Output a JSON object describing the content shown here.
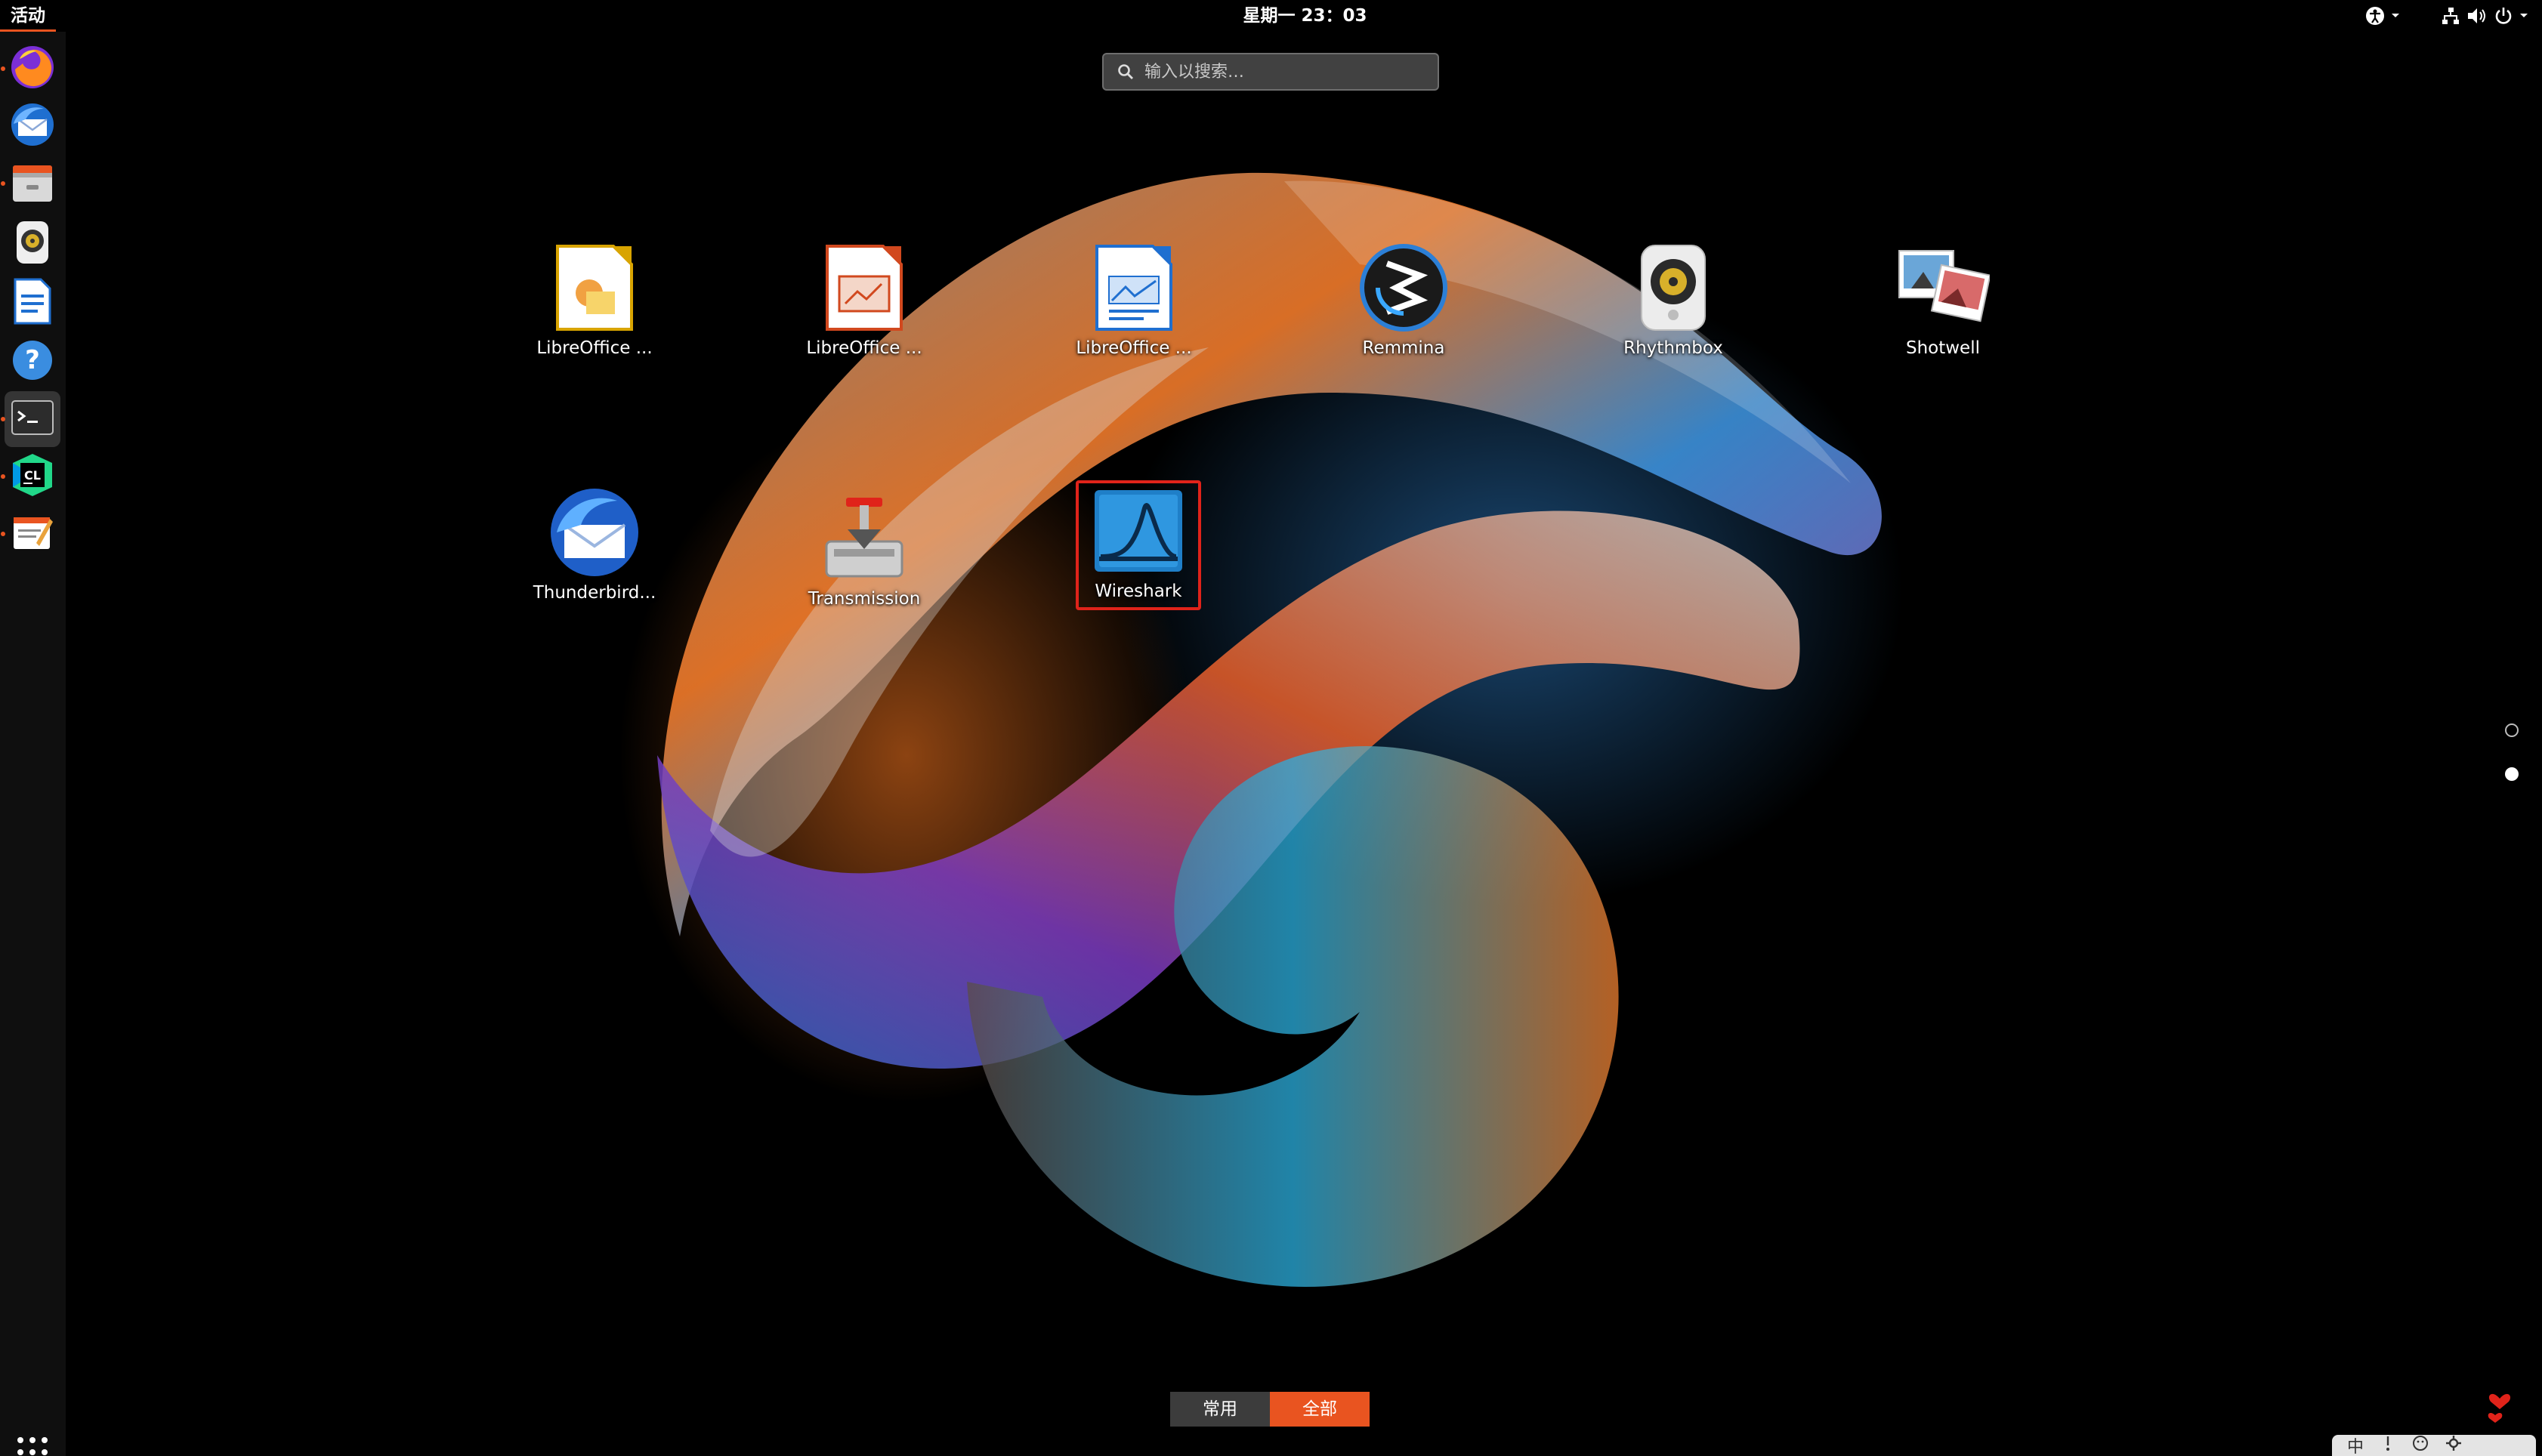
{
  "topbar": {
    "activities_label": "活动",
    "clock": "星期一 23：03"
  },
  "search": {
    "placeholder": "输入以搜索…"
  },
  "dock": {
    "items": [
      {
        "name": "Firefox",
        "icon": "firefox-icon"
      },
      {
        "name": "Thunderbird",
        "icon": "thunderbird-icon"
      },
      {
        "name": "Files",
        "icon": "files-icon"
      },
      {
        "name": "Rhythmbox",
        "icon": "rhythmbox-icon"
      },
      {
        "name": "LibreOffice Writer",
        "icon": "writer-icon"
      },
      {
        "name": "Help",
        "icon": "help-icon"
      },
      {
        "name": "Terminal",
        "icon": "terminal-icon"
      },
      {
        "name": "CLion",
        "icon": "clion-icon"
      },
      {
        "name": "Text Editor",
        "icon": "text-editor-icon"
      }
    ]
  },
  "apps": [
    {
      "label": "LibreOffice ...",
      "icon": "libreoffice-draw-icon"
    },
    {
      "label": "LibreOffice ...",
      "icon": "libreoffice-impress-icon"
    },
    {
      "label": "LibreOffice ...",
      "icon": "libreoffice-writer-icon"
    },
    {
      "label": "Remmina",
      "icon": "remmina-icon"
    },
    {
      "label": "Rhythmbox",
      "icon": "rhythmbox-icon"
    },
    {
      "label": "Shotwell",
      "icon": "shotwell-icon"
    },
    {
      "label": "Thunderbird...",
      "icon": "thunderbird-icon"
    },
    {
      "label": "Transmission",
      "icon": "transmission-icon"
    },
    {
      "label": "Wireshark",
      "icon": "wireshark-icon",
      "selected": true
    }
  ],
  "view_tabs": {
    "frequent": "常用",
    "all": "全部"
  },
  "ime": {
    "lang": "中"
  },
  "colors": {
    "accent": "#e95420",
    "selection": "#e0231a"
  }
}
